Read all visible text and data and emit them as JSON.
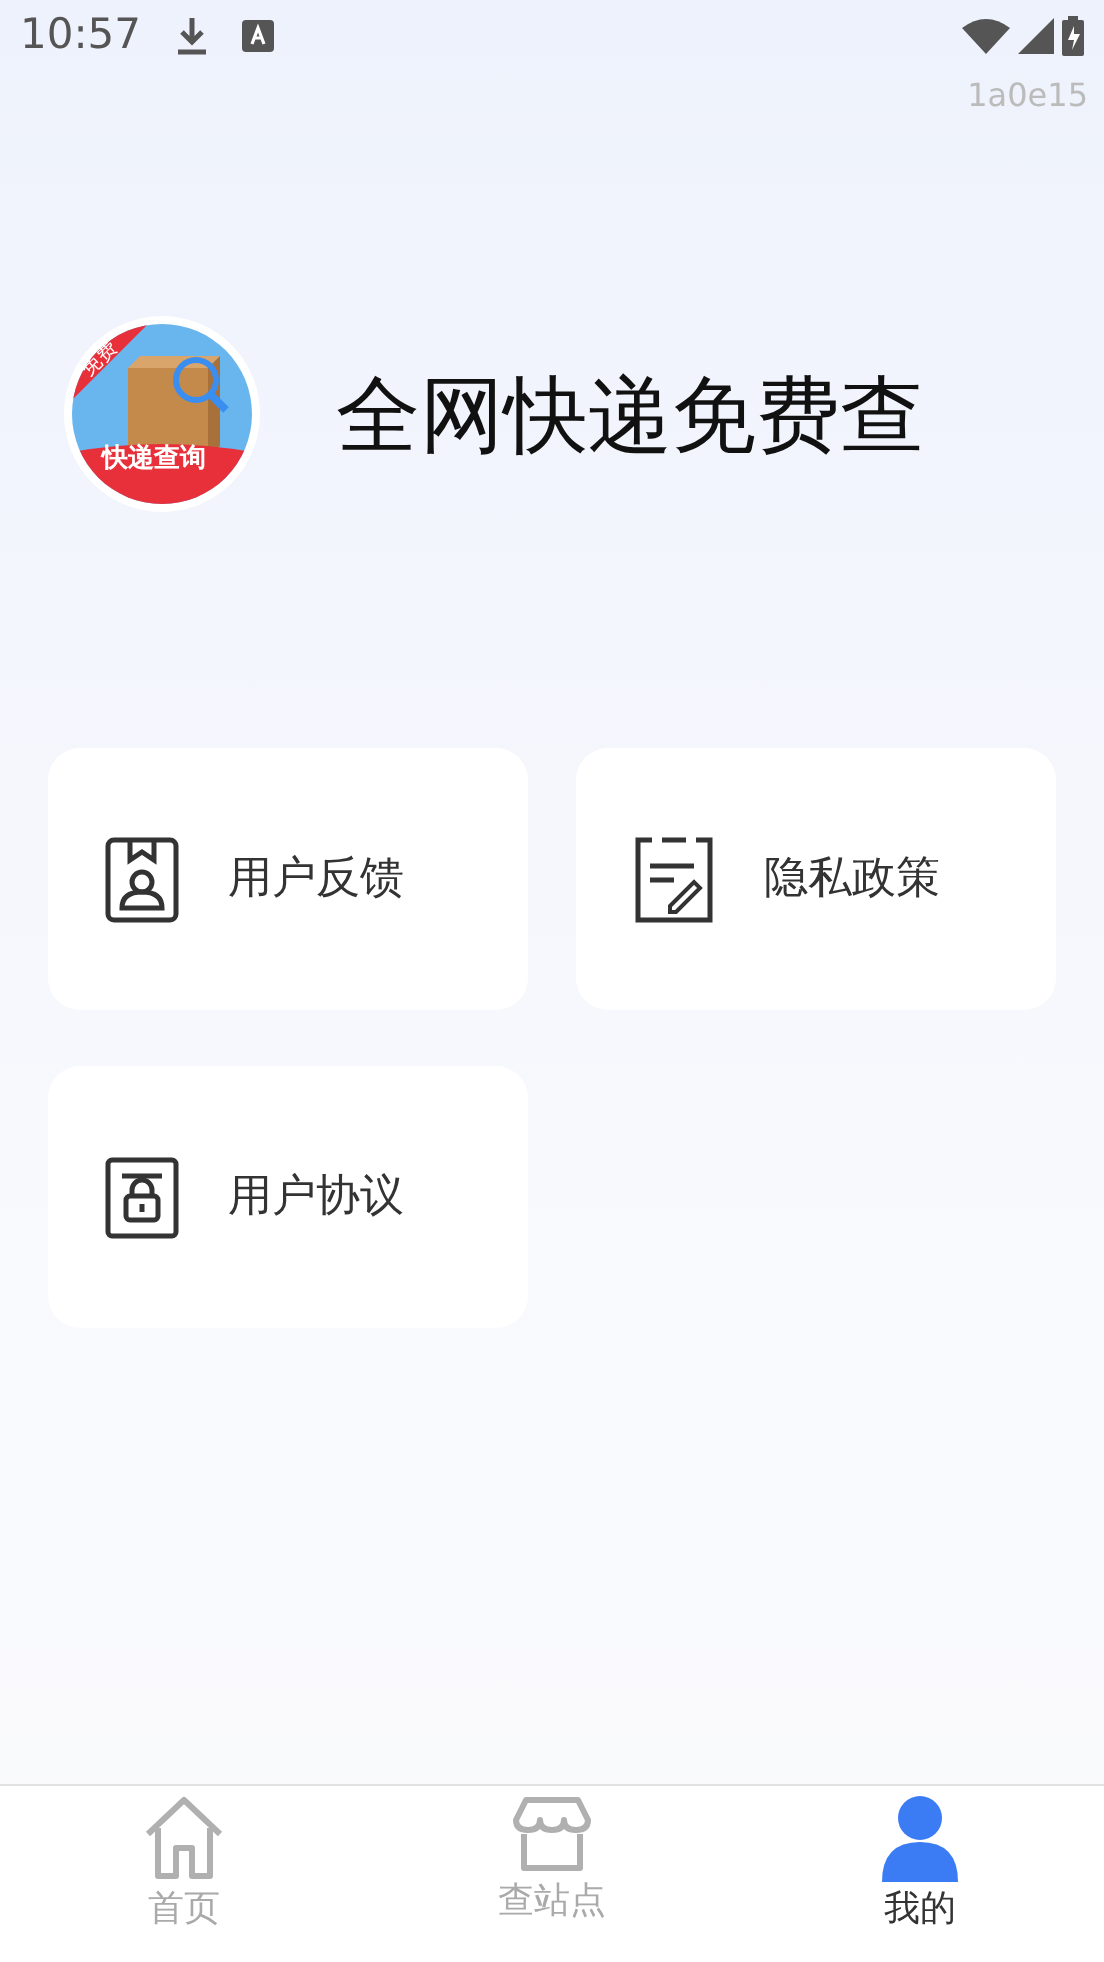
{
  "status_bar": {
    "time": "10:57"
  },
  "build_tag": "1a0e15",
  "logo": {
    "ribbon": "免费",
    "band": "快递查询"
  },
  "app_title": "全网快递免费查",
  "menu": [
    {
      "kind": "feedback",
      "label": "用户反馈"
    },
    {
      "kind": "privacy",
      "label": "隐私政策"
    },
    {
      "kind": "agreement",
      "label": "用户协议"
    }
  ],
  "tabs": [
    {
      "kind": "home",
      "label": "首页",
      "selected": false
    },
    {
      "kind": "station",
      "label": "查站点",
      "selected": false
    },
    {
      "kind": "mine",
      "label": "我的",
      "selected": true
    }
  ]
}
